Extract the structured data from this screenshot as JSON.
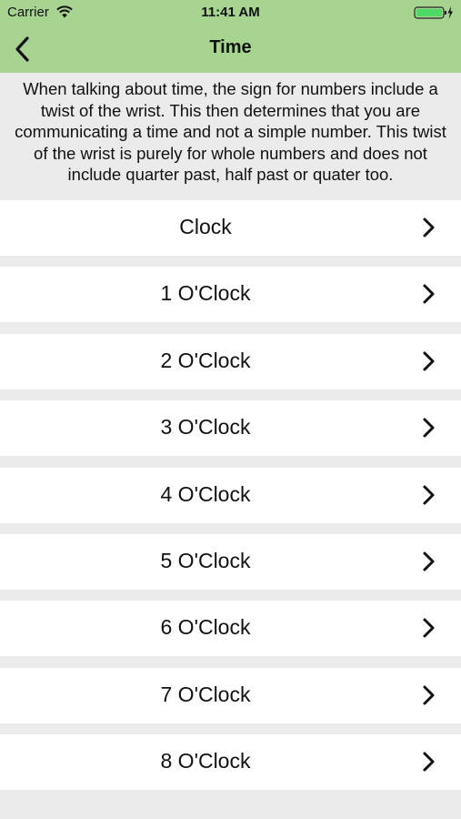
{
  "status_bar": {
    "carrier": "Carrier",
    "time": "11:41 AM"
  },
  "nav": {
    "title": "Time",
    "back_icon": "chevron-left-icon"
  },
  "description": "When talking about time, the sign for numbers include a twist of the wrist. This then determines that you are communicating a time and not a simple number. This twist of the wrist is purely for whole numbers and does not include quarter past, half past or quater too.",
  "items": [
    {
      "label": "Clock"
    },
    {
      "label": "1 O'Clock"
    },
    {
      "label": "2 O'Clock"
    },
    {
      "label": "3 O'Clock"
    },
    {
      "label": "4 O'Clock"
    },
    {
      "label": "5 O'Clock"
    },
    {
      "label": "6 O'Clock"
    },
    {
      "label": "7 O'Clock"
    },
    {
      "label": "8 O'Clock"
    }
  ],
  "colors": {
    "header": "#a8d492",
    "background": "#ebebeb",
    "row": "#ffffff",
    "battery": "#4cd964"
  }
}
